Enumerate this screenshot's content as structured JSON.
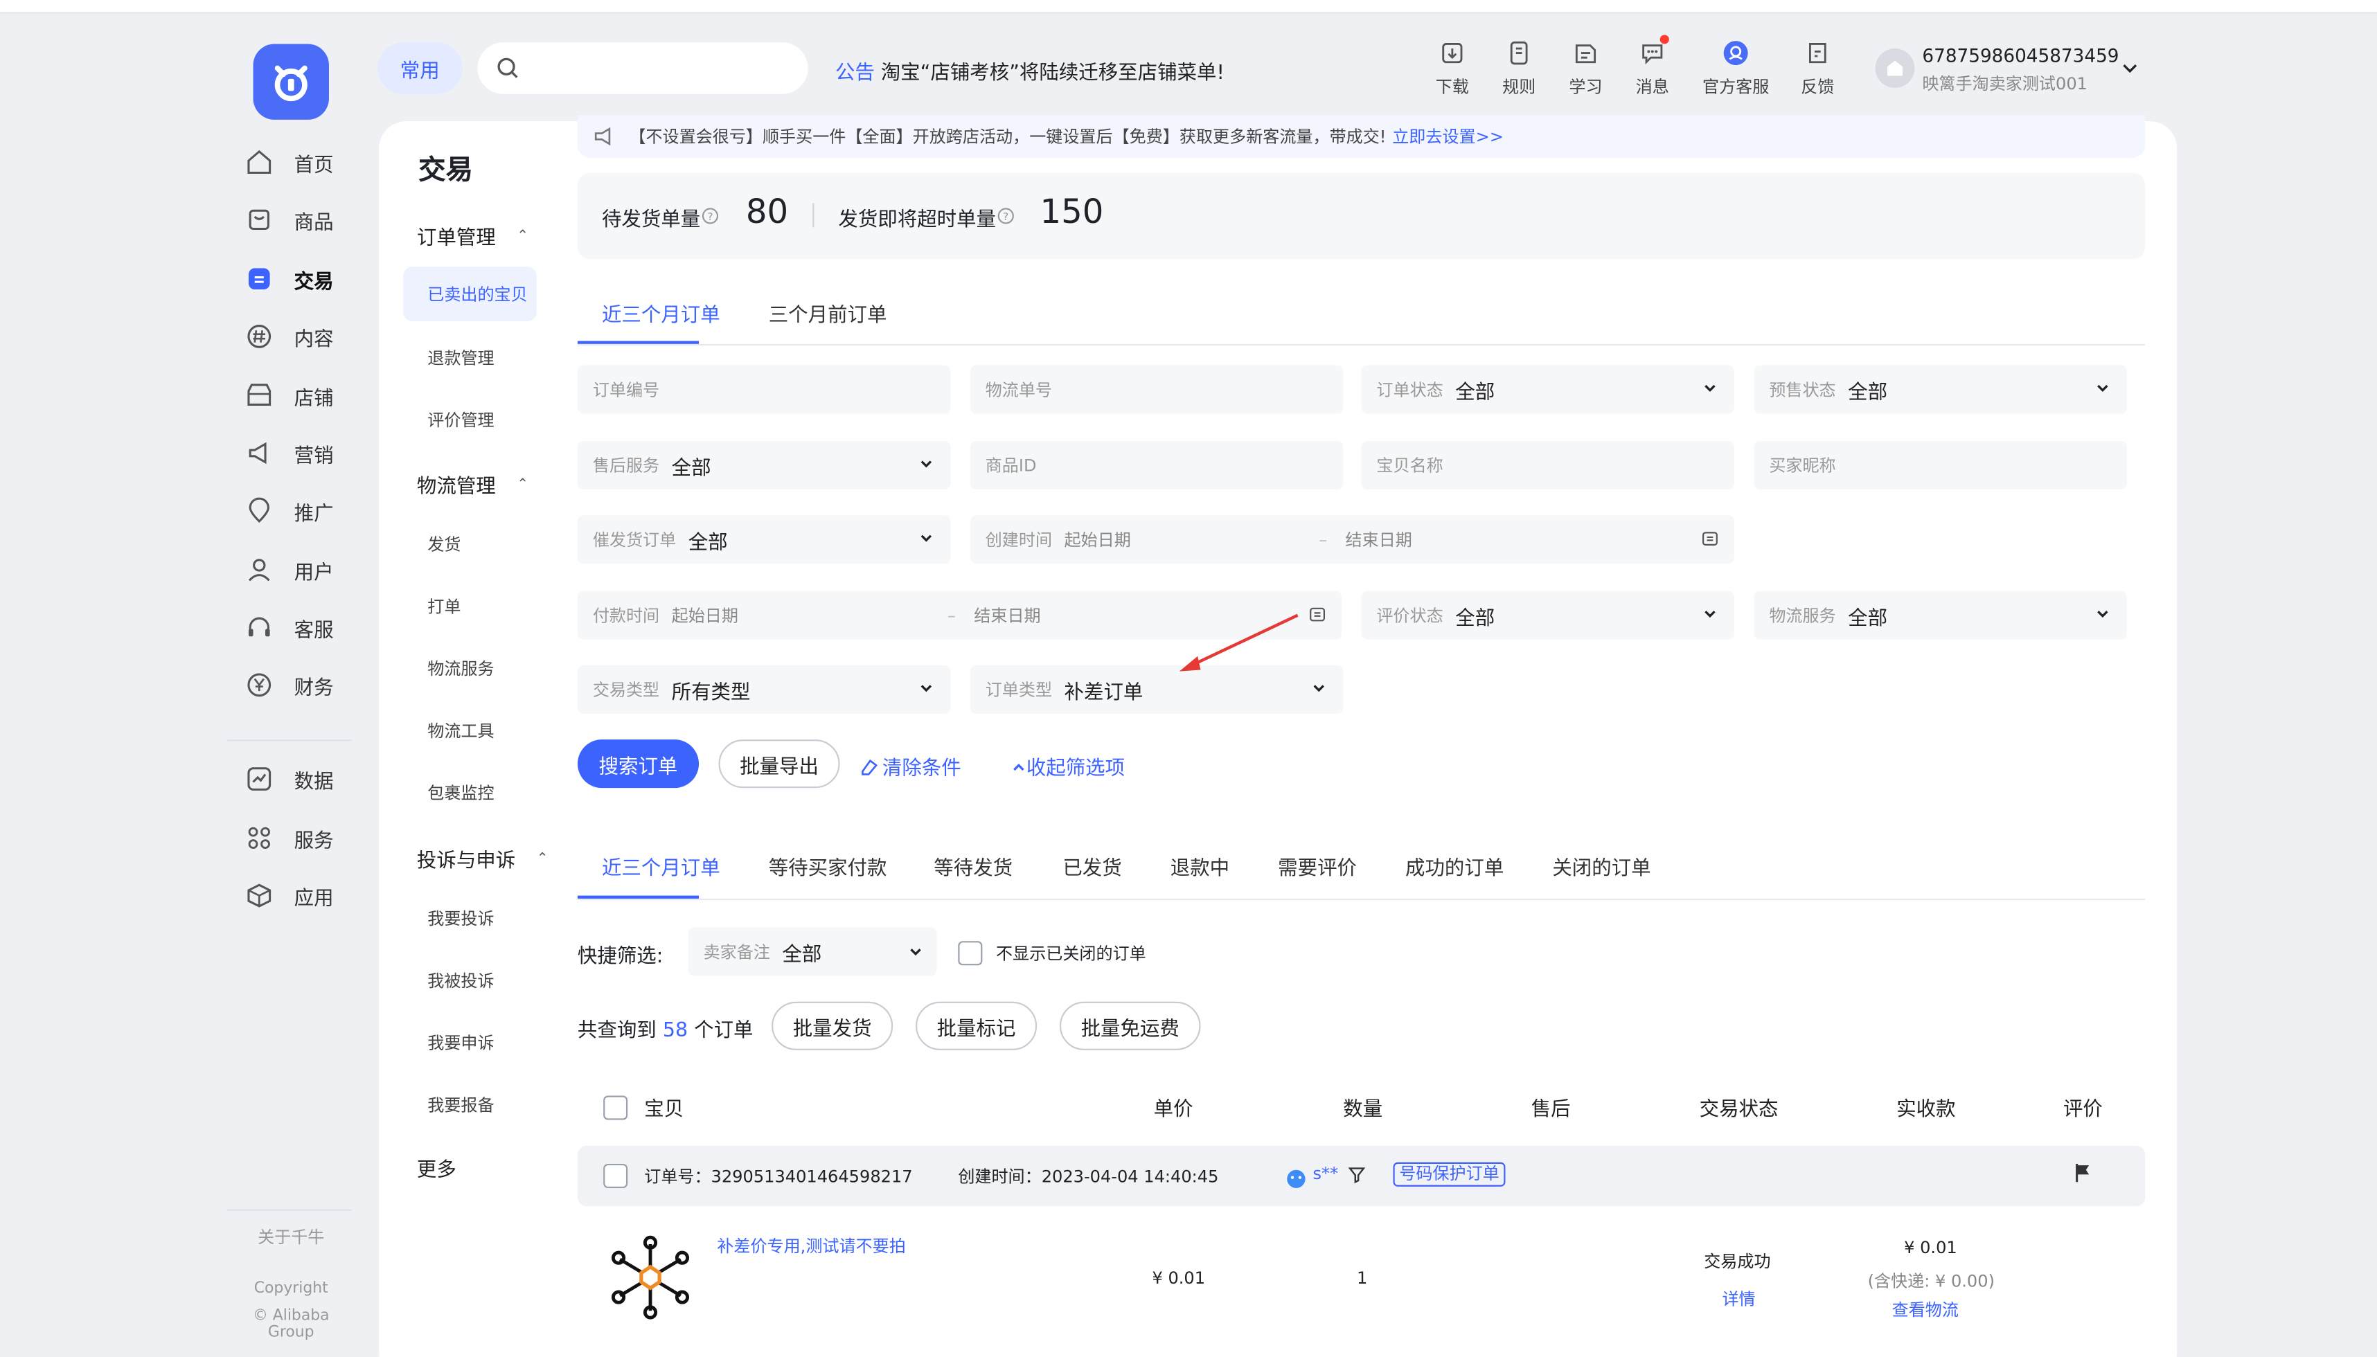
{
  "sidebar": {
    "items": [
      {
        "label": "首页",
        "icon": "home-icon"
      },
      {
        "label": "商品",
        "icon": "goods-icon"
      },
      {
        "label": "交易",
        "icon": "trade-icon"
      },
      {
        "label": "内容",
        "icon": "hash-icon"
      },
      {
        "label": "店铺",
        "icon": "store-icon"
      },
      {
        "label": "营销",
        "icon": "megaphone-icon"
      },
      {
        "label": "推广",
        "icon": "location-icon"
      },
      {
        "label": "用户",
        "icon": "user-icon"
      },
      {
        "label": "客服",
        "icon": "headset-icon"
      },
      {
        "label": "财务",
        "icon": "yen-icon"
      },
      {
        "label": "数据",
        "icon": "chart-icon"
      },
      {
        "label": "服务",
        "icon": "grid-icon"
      },
      {
        "label": "应用",
        "icon": "box-icon"
      }
    ],
    "about": "关于千牛",
    "copyright": "Copyright",
    "company": "© Alibaba Group"
  },
  "header": {
    "pill": "常用",
    "notice_tag": "公告",
    "notice_text": "淘宝“店铺考核”将陆续迁移至店铺菜单!",
    "tools": [
      {
        "label": "下载",
        "icon": "download-icon"
      },
      {
        "label": "规则",
        "icon": "rules-icon"
      },
      {
        "label": "学习",
        "icon": "learn-icon"
      },
      {
        "label": "消息",
        "icon": "message-icon"
      },
      {
        "label": "官方客服",
        "icon": "support-icon"
      },
      {
        "label": "反馈",
        "icon": "feedback-icon"
      }
    ],
    "user_id": "67875986045873459",
    "user_name": "映篱手淘卖家测试001"
  },
  "subnav": {
    "title": "交易",
    "groups": [
      {
        "label": "订单管理",
        "items": [
          "已卖出的宝贝",
          "退款管理",
          "评价管理"
        ]
      },
      {
        "label": "物流管理",
        "items": [
          "发货",
          "打单",
          "物流服务",
          "物流工具",
          "包裹监控"
        ]
      },
      {
        "label": "投诉与申诉",
        "items": [
          "我要投诉",
          "我被投诉",
          "我要申诉",
          "我要报备"
        ]
      }
    ],
    "more": "更多"
  },
  "banner": {
    "text": "【不设置会很亏】顺手买一件【全面】开放跨店活动，一键设置后【免费】获取更多新客流量，带成交!",
    "link": "立即去设置>>"
  },
  "stats": {
    "pending_label": "待发货单量",
    "pending_value": "80",
    "overtime_label": "发货即将超时单量",
    "overtime_value": "150"
  },
  "range_tabs": [
    "近三个月订单",
    "三个月前订单"
  ],
  "filters": {
    "order_no": "订单编号",
    "logistics_no": "物流单号",
    "order_status_label": "订单状态",
    "presale_label": "预售状态",
    "aftersale_label": "售后服务",
    "product_id": "商品ID",
    "item_name": "宝贝名称",
    "buyer_nick": "买家昵称",
    "urge_label": "催发货订单",
    "created_label": "创建时间",
    "start_date": "起始日期",
    "end_date": "结束日期",
    "dash": "–",
    "paid_label": "付款时间",
    "rate_label": "评价状态",
    "logistics_svc_label": "物流服务",
    "trade_type_label": "交易类型",
    "trade_type_value": "所有类型",
    "order_type_label": "订单类型",
    "order_type_value": "补差订单",
    "all": "全部"
  },
  "actions": {
    "search": "搜索订单",
    "export": "批量导出",
    "clear": "清除条件",
    "collapse": "收起筛选项"
  },
  "status_tabs": [
    "近三个月订单",
    "等待买家付款",
    "等待发货",
    "已发货",
    "退款中",
    "需要评价",
    "成功的订单",
    "关闭的订单"
  ],
  "quick_filter": {
    "label": "快捷筛选:",
    "remark_label": "卖家备注",
    "remark_value": "全部",
    "hide_closed": "不显示已关闭的订单"
  },
  "result": {
    "prefix": "共查询到",
    "count": "58",
    "suffix": "个订单",
    "bulk": [
      "批量发货",
      "批量标记",
      "批量免运费"
    ]
  },
  "table": {
    "headers": [
      "宝贝",
      "单价",
      "数量",
      "售后",
      "交易状态",
      "实收款",
      "评价"
    ],
    "order": {
      "order_no": "订单号：3290513401464598217",
      "created": "创建时间：2023-04-04 14:40:45",
      "buyer": "s**",
      "badge": "号码保护订单",
      "item_title": "补差价专用,测试请不要拍",
      "price": "¥ 0.01",
      "qty": "1",
      "status": "交易成功",
      "detail": "详情",
      "paid": "¥ 0.01",
      "shipping": "(含快递: ¥ 0.00)",
      "logistics": "查看物流"
    }
  }
}
